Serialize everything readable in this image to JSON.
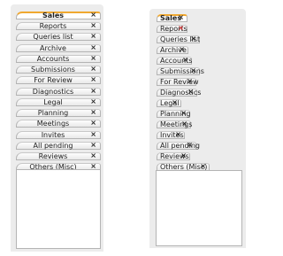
{
  "left_panel": {
    "tabs": [
      {
        "label": "Sales",
        "close": "×",
        "active": true
      },
      {
        "label": "Reports",
        "close": "×"
      },
      {
        "label": "Queries list",
        "close": "×"
      },
      {
        "label": "Archive",
        "close": "×"
      },
      {
        "label": "Accounts",
        "close": "×"
      },
      {
        "label": "Submissions",
        "close": "×"
      },
      {
        "label": "For Review",
        "close": "×"
      },
      {
        "label": "Diagnostics",
        "close": "×"
      },
      {
        "label": "Legal",
        "close": "×"
      },
      {
        "label": "Planning",
        "close": "×"
      },
      {
        "label": "Meetings",
        "close": "×"
      },
      {
        "label": "Invites",
        "close": "×"
      },
      {
        "label": "All pending",
        "close": "×"
      },
      {
        "label": "Reviews",
        "close": "×"
      },
      {
        "label": "Others (Misc)",
        "close": "×"
      }
    ]
  },
  "right_panel": {
    "tabs": [
      {
        "label": "Sales",
        "close": "×",
        "active": true
      },
      {
        "label": "Reports",
        "close": "×",
        "close_color": "#d42b2b"
      },
      {
        "label": "Queries list",
        "close": "×"
      },
      {
        "label": "Archive",
        "close": "×"
      },
      {
        "label": "Accounts",
        "close": "×"
      },
      {
        "label": "Submissions",
        "close": "×"
      },
      {
        "label": "For Review",
        "close": "×"
      },
      {
        "label": "Diagnostics",
        "close": "×"
      },
      {
        "label": "Legal",
        "close": "×"
      },
      {
        "label": "Planning",
        "close": "×"
      },
      {
        "label": "Meetings",
        "close": "×"
      },
      {
        "label": "Invites",
        "close": "×"
      },
      {
        "label": "All pending",
        "close": "×"
      },
      {
        "label": "Reviews",
        "close": "×"
      },
      {
        "label": "Others (Misc)",
        "close": "×"
      }
    ]
  },
  "colors": {
    "active_tab_accent": "#f0a830",
    "hover_close_red": "#d42b2b",
    "panel_bg": "#ececec",
    "tab_border": "#b4b4b4"
  }
}
